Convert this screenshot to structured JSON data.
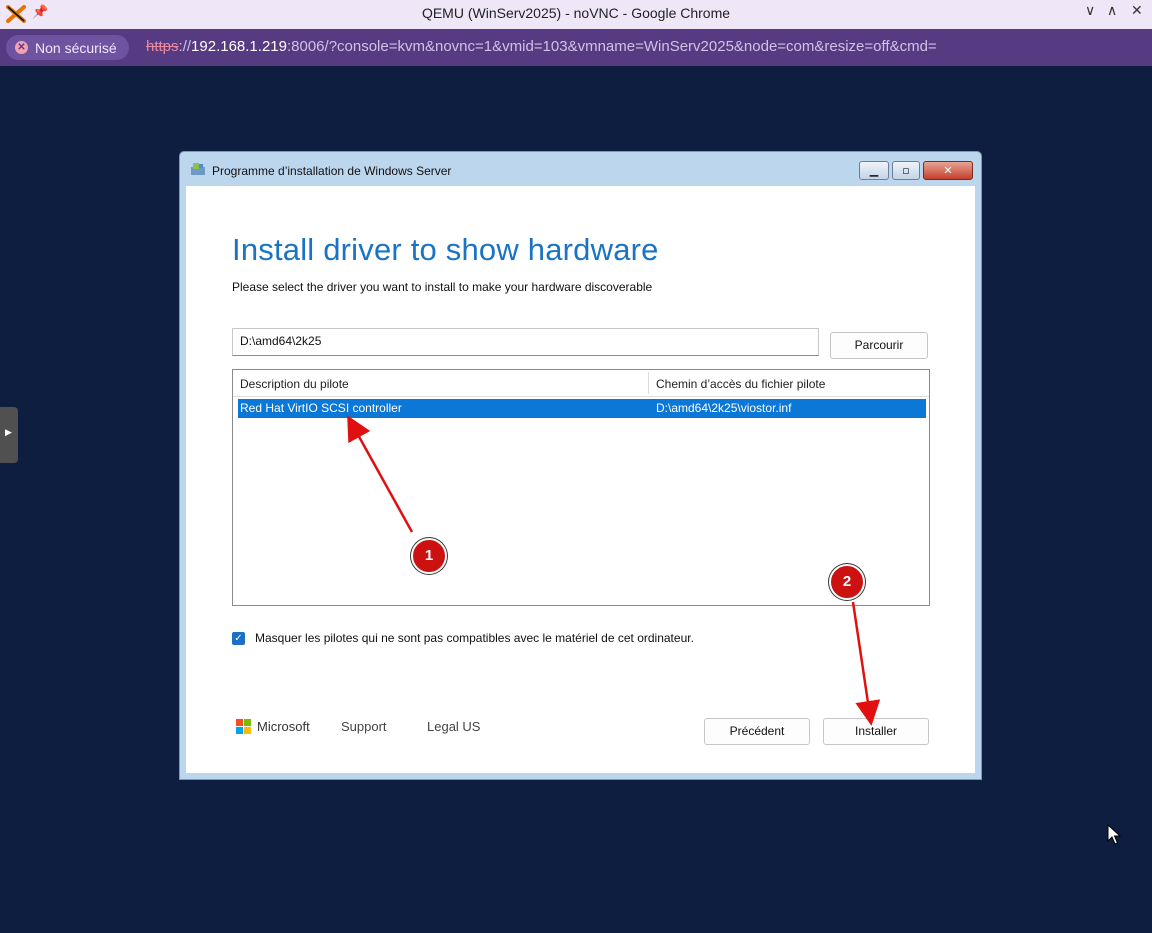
{
  "browser": {
    "window_title": "QEMU (WinServ2025) - noVNC - Google Chrome",
    "security_chip": "Non sécurisé",
    "url_scheme": "https",
    "url_sep": "://",
    "url_host": "192.168.1.219",
    "url_rest": ":8006/?console=kvm&novnc=1&vmid=103&vmname=WinServ2025&node=com&resize=off&cmd=",
    "icons": [
      "app-logo-icon",
      "pin-icon",
      "chevron-down-icon",
      "chevron-up-icon",
      "close-icon"
    ]
  },
  "setup_window": {
    "title": "Programme d’installation de Windows Server",
    "heading": "Install driver to show hardware",
    "subheading": "Please select the driver you want to install to make your hardware discoverable",
    "path_value": "D:\\amd64\\2k25",
    "browse_label": "Parcourir",
    "columns": [
      "Description du pilote",
      "Chemin d’accès du fichier pilote"
    ],
    "rows": [
      {
        "description": "Red Hat VirtIO SCSI controller",
        "path": "D:\\amd64\\2k25\\viostor.inf",
        "selected": true
      }
    ],
    "hide_incompatible_label": "Masquer les pilotes qui ne sont pas compatibles avec le matériel de cet ordinateur.",
    "hide_incompatible_checked": true,
    "footer": {
      "brand": "Microsoft",
      "support": "Support",
      "legal": "Legal US"
    },
    "back_label": "Précédent",
    "install_label": "Installer"
  },
  "annotations": [
    {
      "number": "1"
    },
    {
      "number": "2"
    }
  ],
  "colors": {
    "vnc_background": "#0e1e40",
    "addressbar": "#573b82",
    "heading_blue": "#1a73c4",
    "selection_blue": "#0b77d6",
    "annotation_red": "#cc1111"
  }
}
